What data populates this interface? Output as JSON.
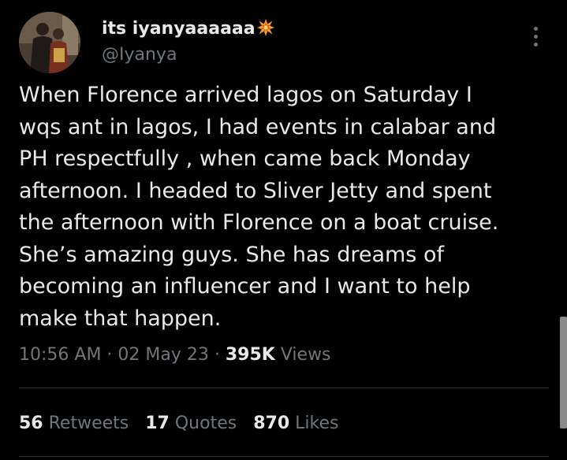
{
  "author": {
    "display_name": "its iyanyaaaaaa",
    "handle": "@Iyanya",
    "name_emoji_icon": "collision-burst-icon"
  },
  "tweet": {
    "lines": [
      "When Florence arrived lagos on Saturday I",
      "wqs ant in lagos, I had events in calabar and",
      "PH respectfully , when came back Monday",
      "afternoon. I headed to Sliver Jetty and spent",
      "the afternoon with Florence on a boat cruise.",
      "She’s  amazing guys. She has dreams of",
      "becoming an influencer and I want to help",
      "make that happen."
    ]
  },
  "meta": {
    "time": "10:56 AM",
    "separator": " · ",
    "date": "02 May 23",
    "views_count": "395K",
    "views_label": " Views"
  },
  "stats": {
    "retweets": {
      "count": "56",
      "label": " Retweets"
    },
    "quotes": {
      "count": "17",
      "label": " Quotes"
    },
    "likes": {
      "count": "870",
      "label": " Likes"
    }
  },
  "colors": {
    "background": "#000000",
    "text_primary": "#e7e9ea",
    "text_secondary": "#71767b",
    "divider": "#2f3336"
  }
}
